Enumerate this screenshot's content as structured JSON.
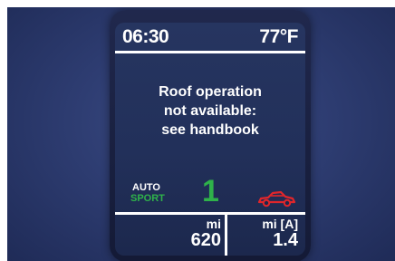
{
  "status_bar": {
    "time": "06:30",
    "temperature": "77°F"
  },
  "message": {
    "lines": [
      "Roof operation",
      "not available:",
      "see handbook"
    ]
  },
  "drive_mode": {
    "auto_label": "AUTO",
    "sport_label": "SPORT",
    "gear": "1",
    "roof_icon": "convertible-car-icon"
  },
  "odometer": {
    "unit": "mi",
    "value": "620"
  },
  "trip": {
    "unit": "mi [A]",
    "value": "1.4"
  },
  "colors": {
    "background": "#2e3d72",
    "screen": "#22305a",
    "text": "#ffffff",
    "accent_green": "#2fb24a",
    "warning_red": "#e0262b"
  }
}
